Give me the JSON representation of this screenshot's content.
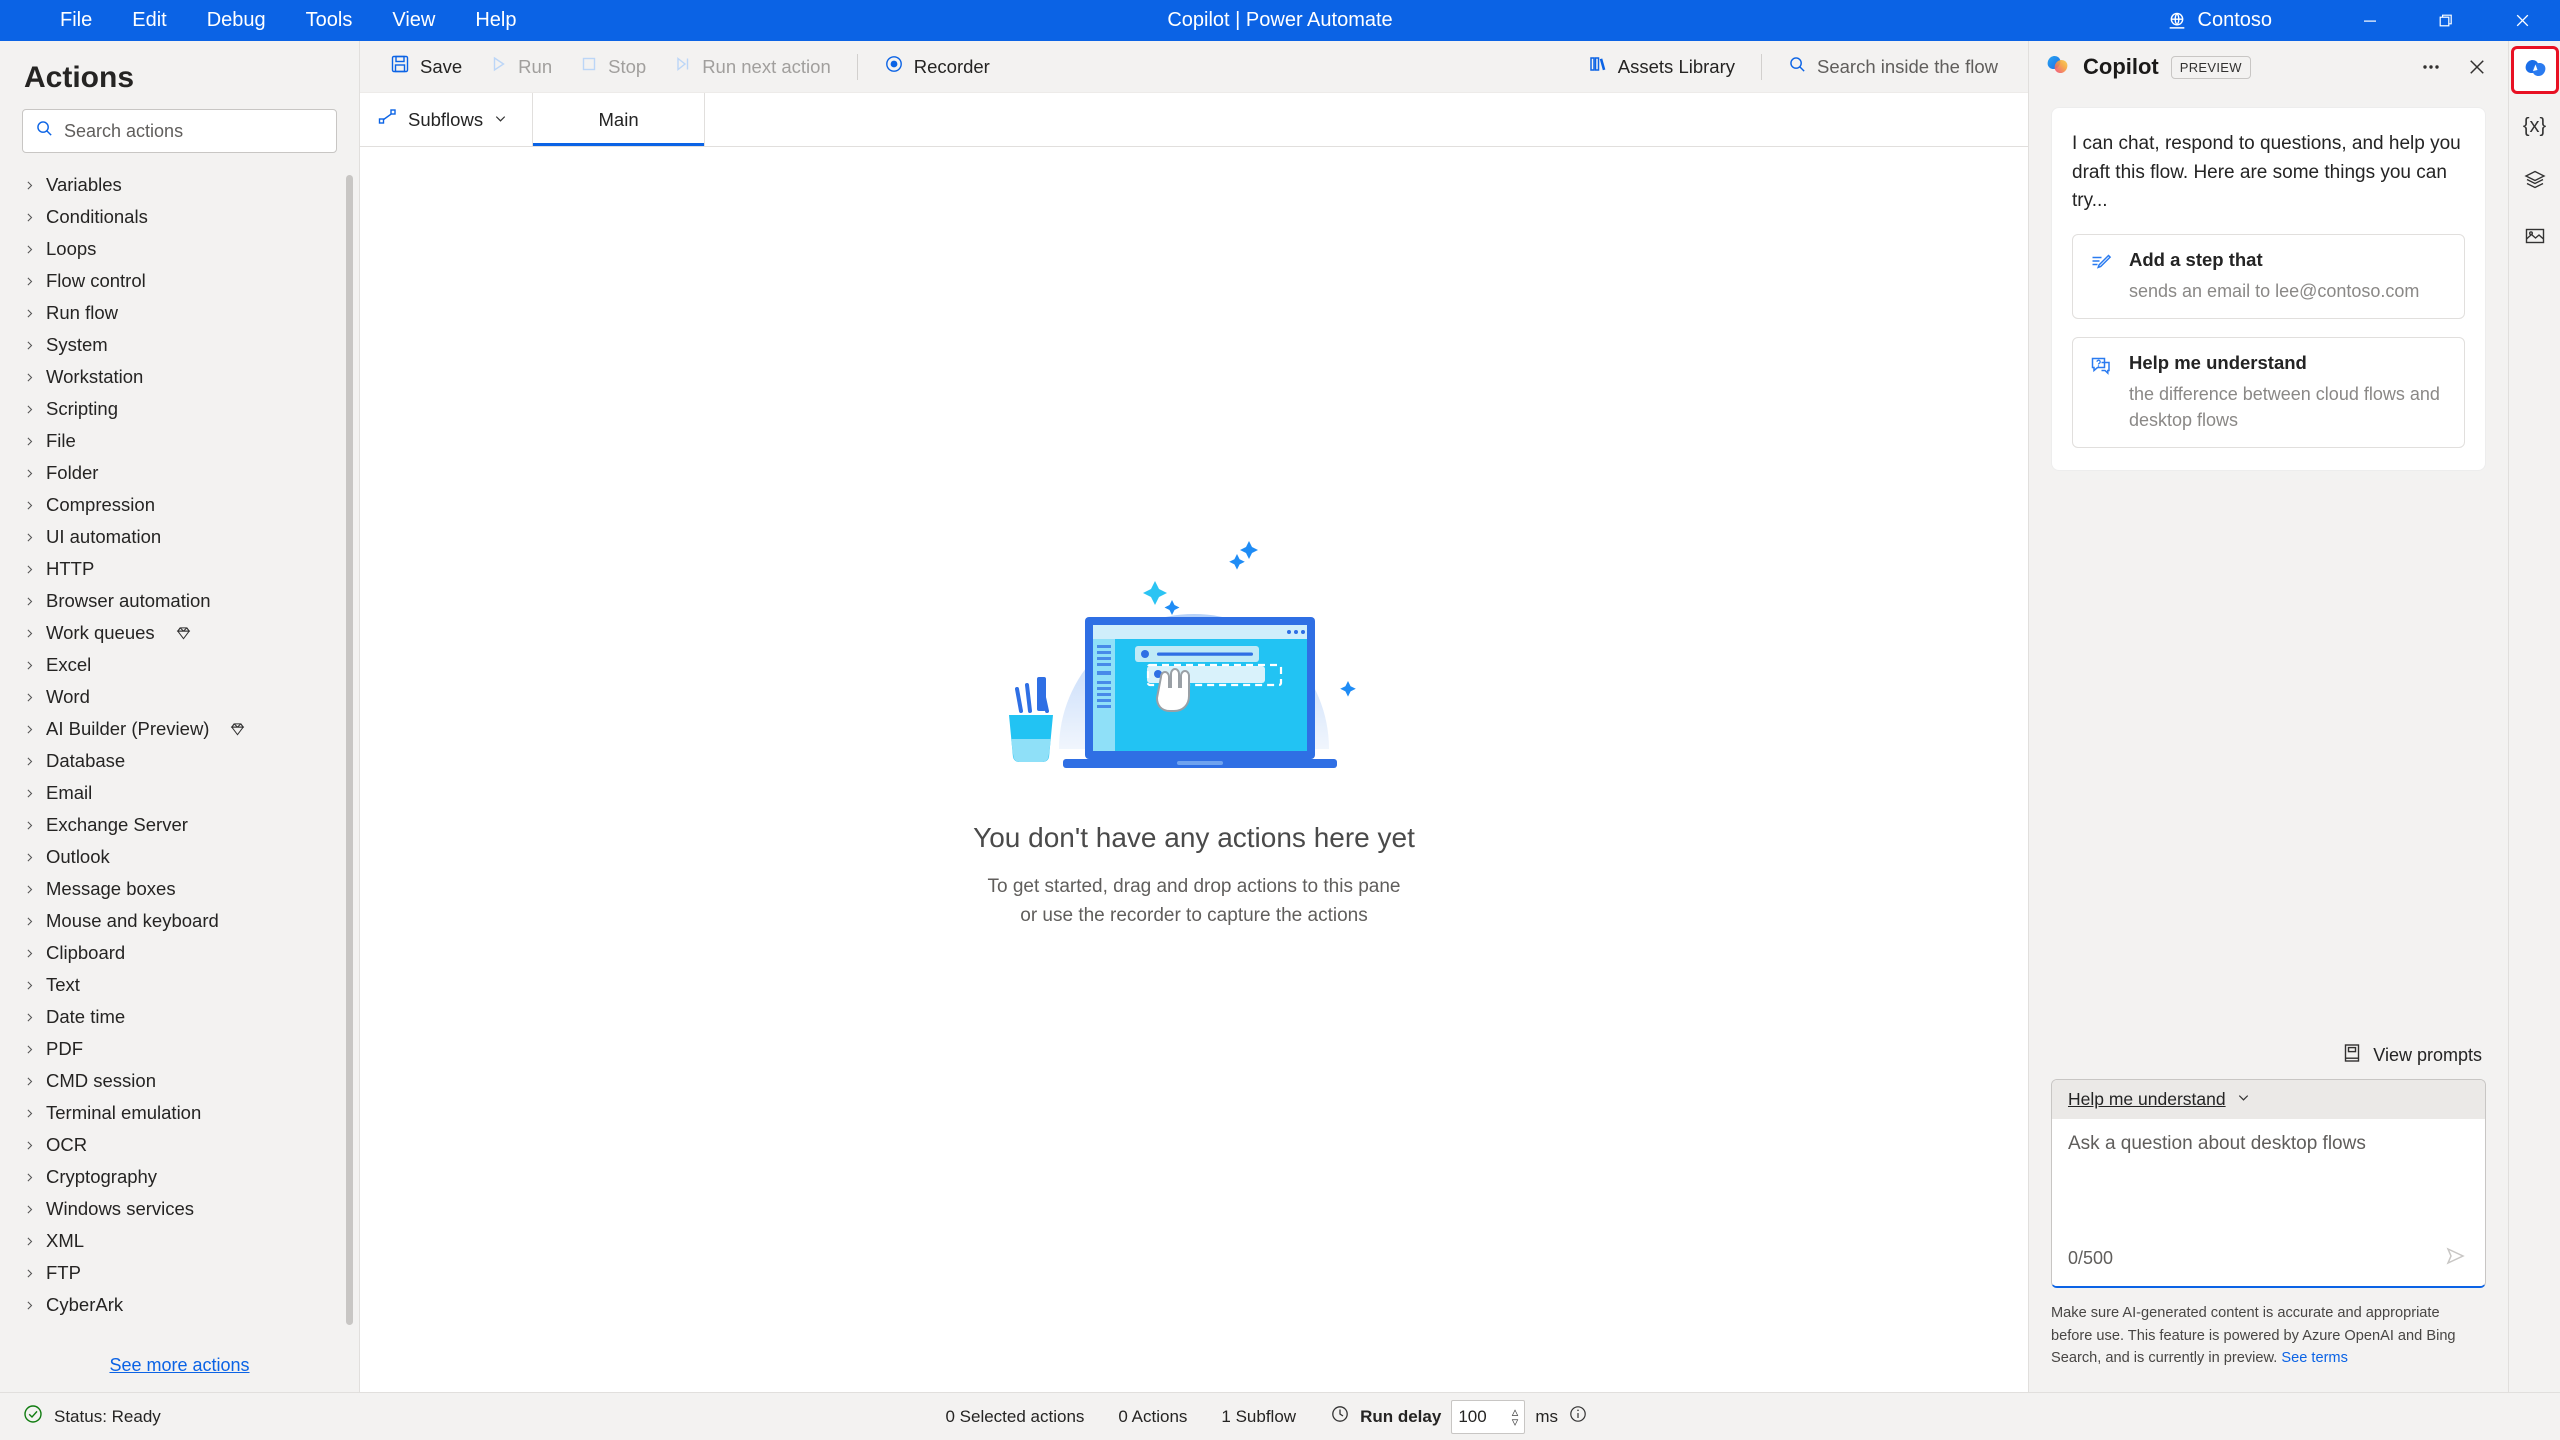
{
  "titlebar": {
    "menu": [
      "File",
      "Edit",
      "Debug",
      "Tools",
      "View",
      "Help"
    ],
    "title": "Copilot | Power Automate",
    "org": "Contoso",
    "window_controls": {
      "minimize": "minimize-icon",
      "maximize": "maximize-icon",
      "close": "close-icon"
    }
  },
  "sidebar": {
    "title": "Actions",
    "search_placeholder": "Search actions",
    "see_more": "See more actions",
    "items": [
      {
        "label": "Variables",
        "premium": false
      },
      {
        "label": "Conditionals",
        "premium": false
      },
      {
        "label": "Loops",
        "premium": false
      },
      {
        "label": "Flow control",
        "premium": false
      },
      {
        "label": "Run flow",
        "premium": false
      },
      {
        "label": "System",
        "premium": false
      },
      {
        "label": "Workstation",
        "premium": false
      },
      {
        "label": "Scripting",
        "premium": false
      },
      {
        "label": "File",
        "premium": false
      },
      {
        "label": "Folder",
        "premium": false
      },
      {
        "label": "Compression",
        "premium": false
      },
      {
        "label": "UI automation",
        "premium": false
      },
      {
        "label": "HTTP",
        "premium": false
      },
      {
        "label": "Browser automation",
        "premium": false
      },
      {
        "label": "Work queues",
        "premium": true
      },
      {
        "label": "Excel",
        "premium": false
      },
      {
        "label": "Word",
        "premium": false
      },
      {
        "label": "AI Builder (Preview)",
        "premium": true
      },
      {
        "label": "Database",
        "premium": false
      },
      {
        "label": "Email",
        "premium": false
      },
      {
        "label": "Exchange Server",
        "premium": false
      },
      {
        "label": "Outlook",
        "premium": false
      },
      {
        "label": "Message boxes",
        "premium": false
      },
      {
        "label": "Mouse and keyboard",
        "premium": false
      },
      {
        "label": "Clipboard",
        "premium": false
      },
      {
        "label": "Text",
        "premium": false
      },
      {
        "label": "Date time",
        "premium": false
      },
      {
        "label": "PDF",
        "premium": false
      },
      {
        "label": "CMD session",
        "premium": false
      },
      {
        "label": "Terminal emulation",
        "premium": false
      },
      {
        "label": "OCR",
        "premium": false
      },
      {
        "label": "Cryptography",
        "premium": false
      },
      {
        "label": "Windows services",
        "premium": false
      },
      {
        "label": "XML",
        "premium": false
      },
      {
        "label": "FTP",
        "premium": false
      },
      {
        "label": "CyberArk",
        "premium": false
      }
    ]
  },
  "toolbar": {
    "save": "Save",
    "run": "Run",
    "stop": "Stop",
    "run_next": "Run next action",
    "recorder": "Recorder",
    "assets_library": "Assets Library",
    "search_flow": "Search inside the flow"
  },
  "tabs": {
    "subflows": "Subflows",
    "items": [
      {
        "label": "Main",
        "active": true
      }
    ]
  },
  "canvas": {
    "empty_title": "You don't have any actions here yet",
    "empty_sub_line1": "To get started, drag and drop actions to this pane",
    "empty_sub_line2": "or use the recorder to capture the actions"
  },
  "copilot": {
    "title": "Copilot",
    "preview_badge": "PREVIEW",
    "intro": "I can chat, respond to questions, and help you draft this flow. Here are some things you can try...",
    "suggestions": [
      {
        "title": "Add a step that",
        "subtitle": "sends an email to lee@contoso.com",
        "icon": "pencil-edit-icon"
      },
      {
        "title": "Help me understand",
        "subtitle": "the difference between cloud flows and desktop flows",
        "icon": "question-bubble-icon"
      }
    ],
    "view_prompts": "View prompts",
    "compose_mode": "Help me understand",
    "input_placeholder": "Ask a question about desktop flows",
    "counter": "0/500",
    "disclaimer": "Make sure AI-generated content is accurate and appropriate before use. This feature is powered by Azure OpenAI and Bing Search, and is currently in preview. ",
    "disclaimer_link": "See terms"
  },
  "rail": {
    "items": [
      {
        "name": "copilot-icon",
        "selected": true
      },
      {
        "name": "variables-icon",
        "glyph": "{x}",
        "selected": false
      },
      {
        "name": "ui-elements-icon",
        "selected": false
      },
      {
        "name": "images-icon",
        "selected": false
      }
    ]
  },
  "statusbar": {
    "status": "Status: Ready",
    "selected_actions": "0 Selected actions",
    "actions": "0 Actions",
    "subflows": "1 Subflow",
    "run_delay_label": "Run delay",
    "run_delay_value": "100",
    "ms": "ms"
  },
  "colors": {
    "accent": "#0b63e5",
    "chrome": "#f3f2f1",
    "highlight_red": "#e81123"
  }
}
